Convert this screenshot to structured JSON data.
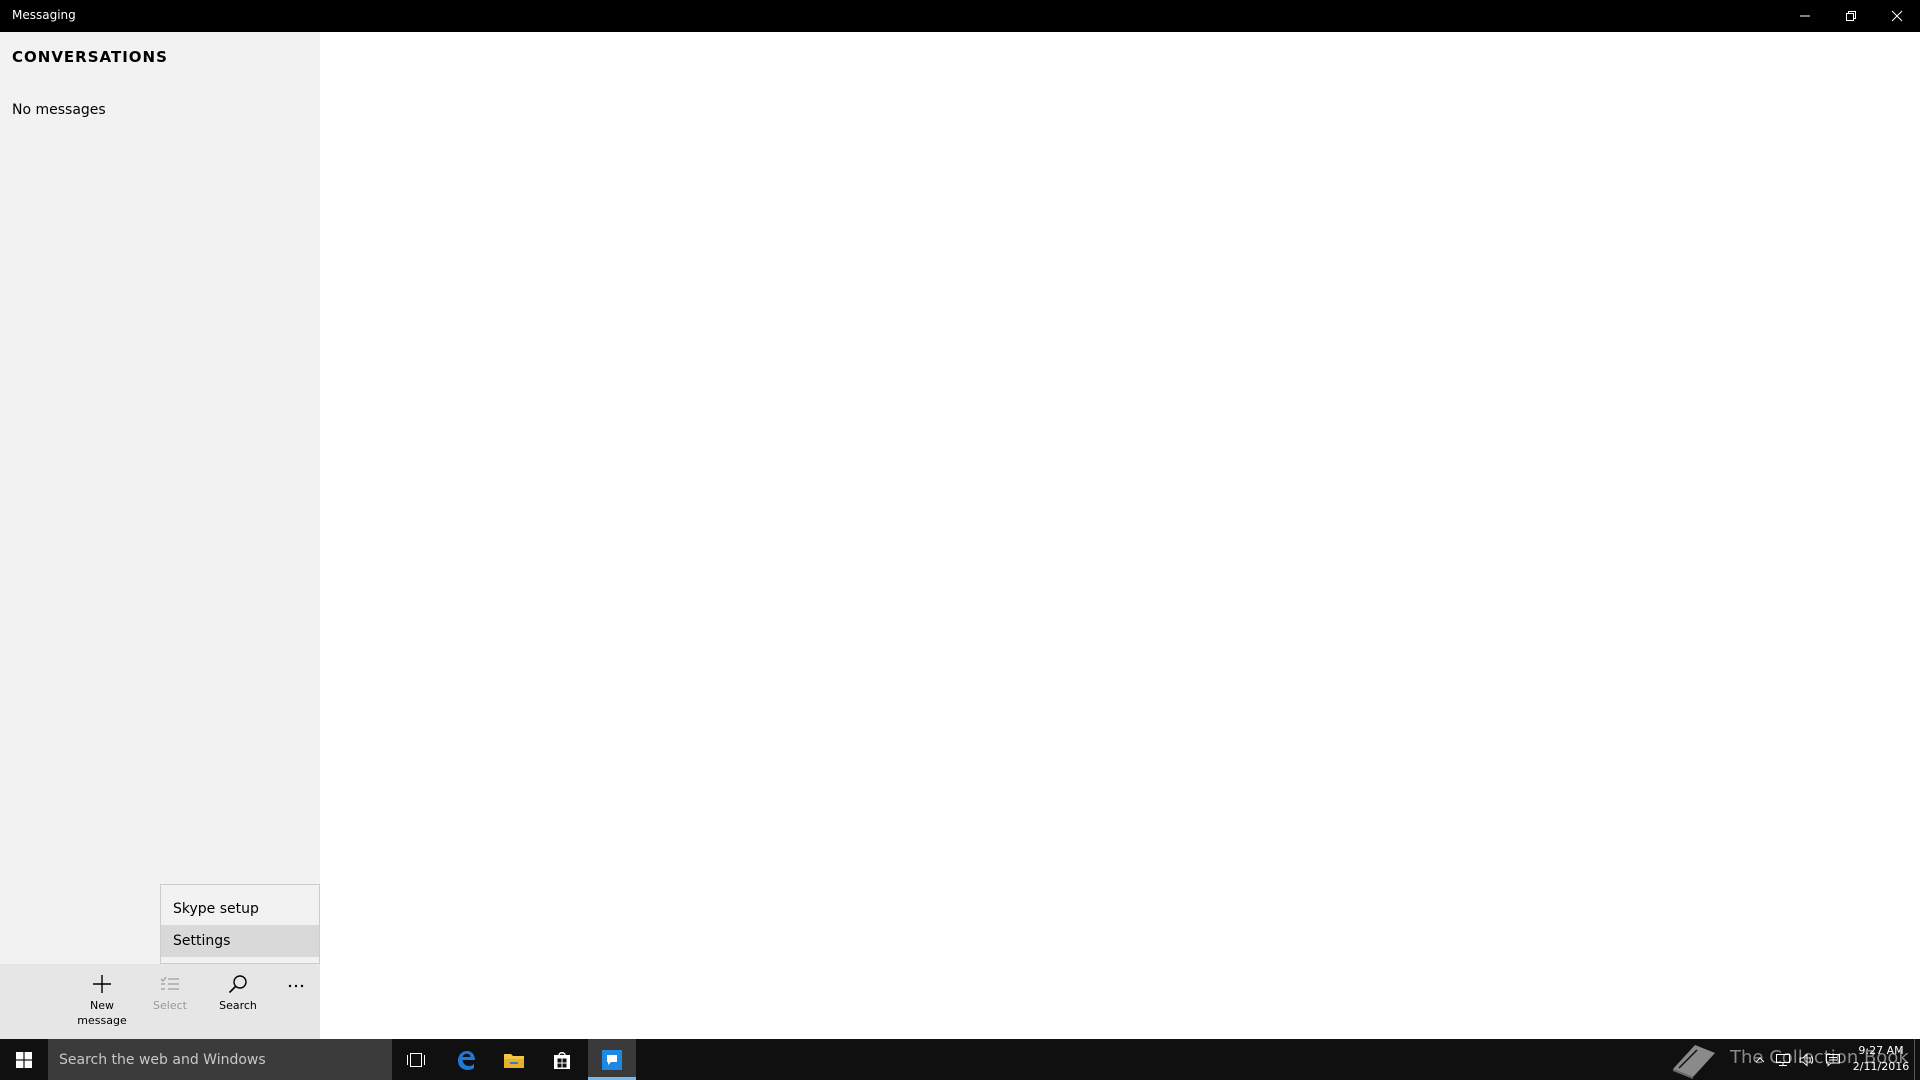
{
  "window": {
    "title": "Messaging",
    "controls": {
      "minimize": "minimize-icon",
      "restore": "restore-icon",
      "close": "close-icon"
    }
  },
  "sidebar": {
    "title": "CONVERSATIONS",
    "empty_text": "No messages"
  },
  "menu": {
    "items": [
      {
        "label": "Skype setup",
        "highlighted": false
      },
      {
        "label": "Settings",
        "highlighted": true
      }
    ]
  },
  "appbar": {
    "buttons": [
      {
        "label": "New\nmessage",
        "icon": "plus-icon",
        "enabled": true
      },
      {
        "label": "Select",
        "icon": "select-list-icon",
        "enabled": false
      },
      {
        "label": "Search",
        "icon": "search-icon",
        "enabled": true
      },
      {
        "label": "",
        "icon": "more-icon",
        "enabled": true
      }
    ]
  },
  "taskbar": {
    "search_placeholder": "Search the web and Windows",
    "watermark": "The Collection Book",
    "time": "9:27 AM",
    "date": "2/11/2016",
    "colors": {
      "background": "#101010",
      "search_bg": "#3b3b3b",
      "active_indicator": "#76b9ed",
      "edge": "#1e7ad8",
      "explorer": "#f4c542",
      "messaging": "#1e88e5"
    }
  }
}
